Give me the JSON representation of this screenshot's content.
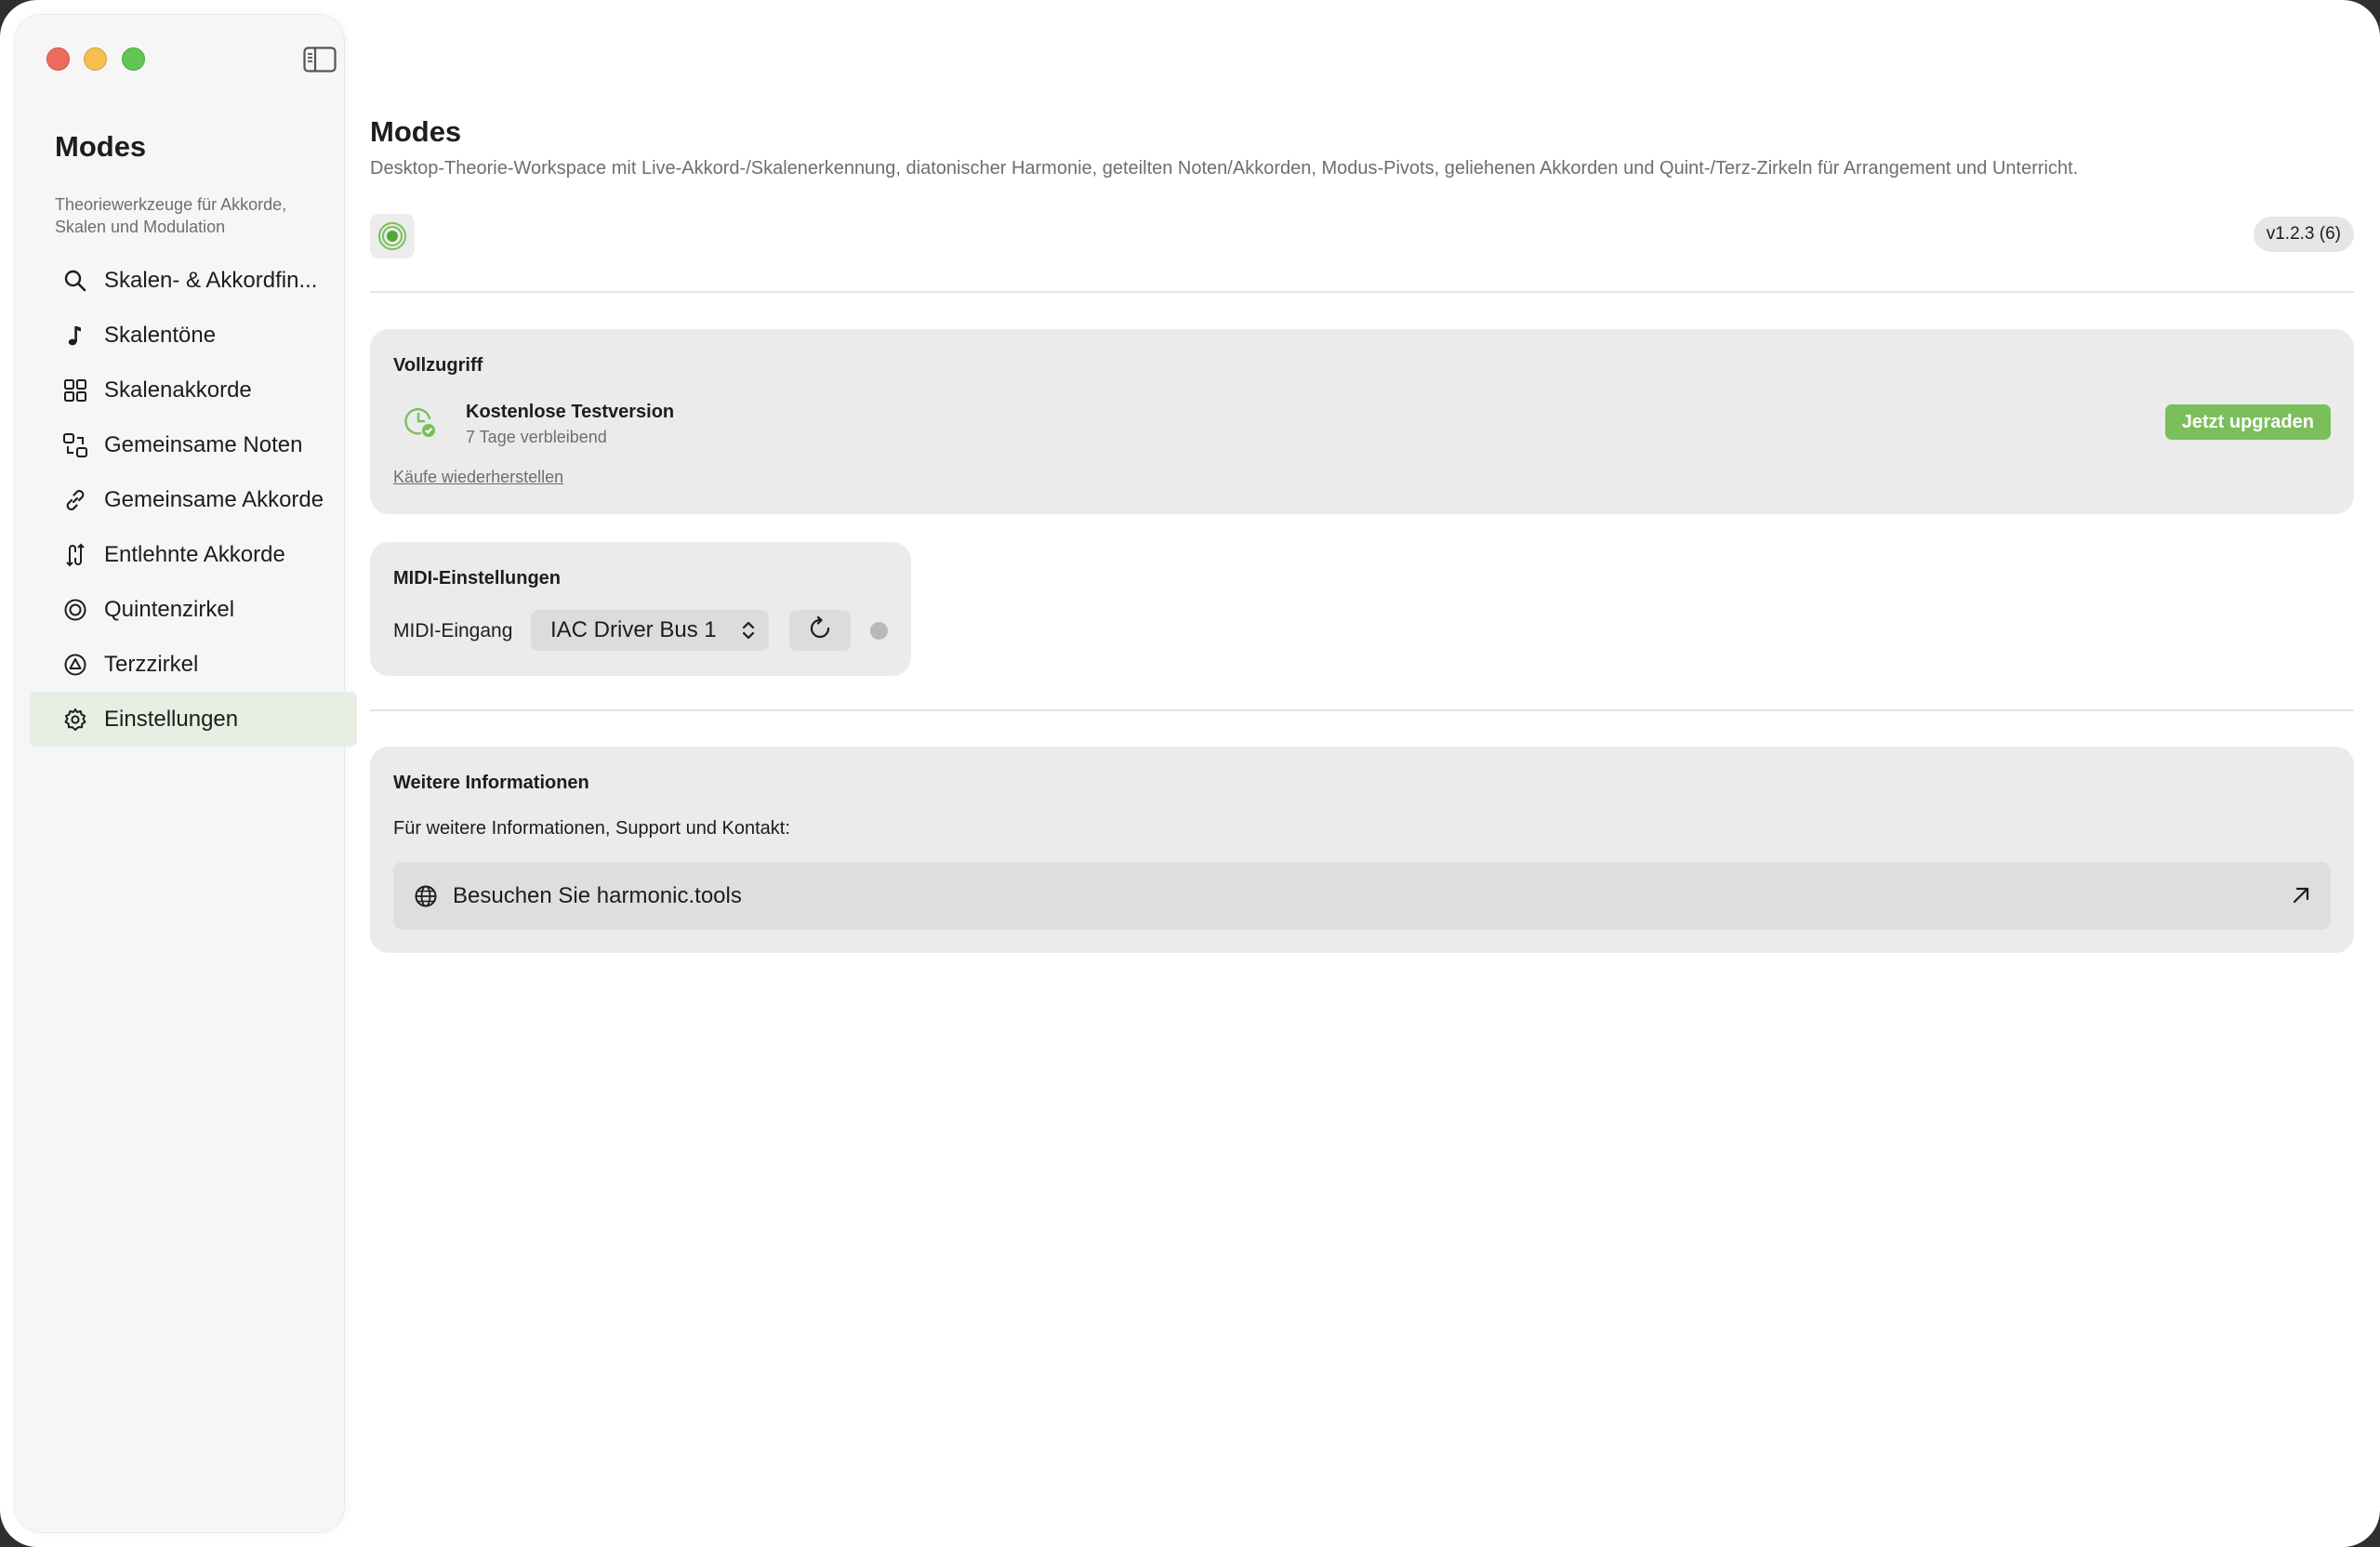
{
  "sidebar": {
    "app_title": "Modes",
    "app_subtitle": "Theoriewerkzeuge für Akkorde, Skalen und Modulation",
    "items": [
      {
        "label": "Skalen- & Akkordfin...",
        "icon": "search-icon"
      },
      {
        "label": "Skalentöne",
        "icon": "music-note-icon"
      },
      {
        "label": "Skalenakkorde",
        "icon": "grid-icon"
      },
      {
        "label": "Gemeinsame Noten",
        "icon": "swap-shapes-icon"
      },
      {
        "label": "Gemeinsame Akkorde",
        "icon": "link-icon"
      },
      {
        "label": "Entlehnte Akkorde",
        "icon": "arrows-swap-icon"
      },
      {
        "label": "Quintenzirkel",
        "icon": "circle-target-icon"
      },
      {
        "label": "Terzzirkel",
        "icon": "triangle-circle-icon"
      },
      {
        "label": "Einstellungen",
        "icon": "gear-icon",
        "active": true
      }
    ]
  },
  "header": {
    "title": "Modes",
    "description": "Desktop-Theorie-Workspace mit Live-Akkord-/Skalenerkennung, diatonischer Harmonie, geteilten Noten/Akkorden, Modus-Pivots, geliehenen Akkorden und Quint-/Terz-Zirkeln für Arrangement und Unterricht.",
    "version": "v1.2.3 (6)"
  },
  "access": {
    "title": "Vollzugriff",
    "trial_title": "Kostenlose Testversion",
    "trial_days": "7 Tage verbleibend",
    "restore_link": "Käufe wiederherstellen",
    "upgrade_button": "Jetzt upgraden"
  },
  "midi": {
    "title": "MIDI-Einstellungen",
    "input_label": "MIDI-Eingang",
    "selected_input": "IAC Driver Bus 1"
  },
  "info": {
    "title": "Weitere Informationen",
    "text": "Für weitere Informationen, Support und Kontakt:",
    "link_label": "Besuchen Sie harmonic.tools"
  },
  "colors": {
    "accent": "#7bbf5b",
    "active_nav": "#e7eee2"
  }
}
